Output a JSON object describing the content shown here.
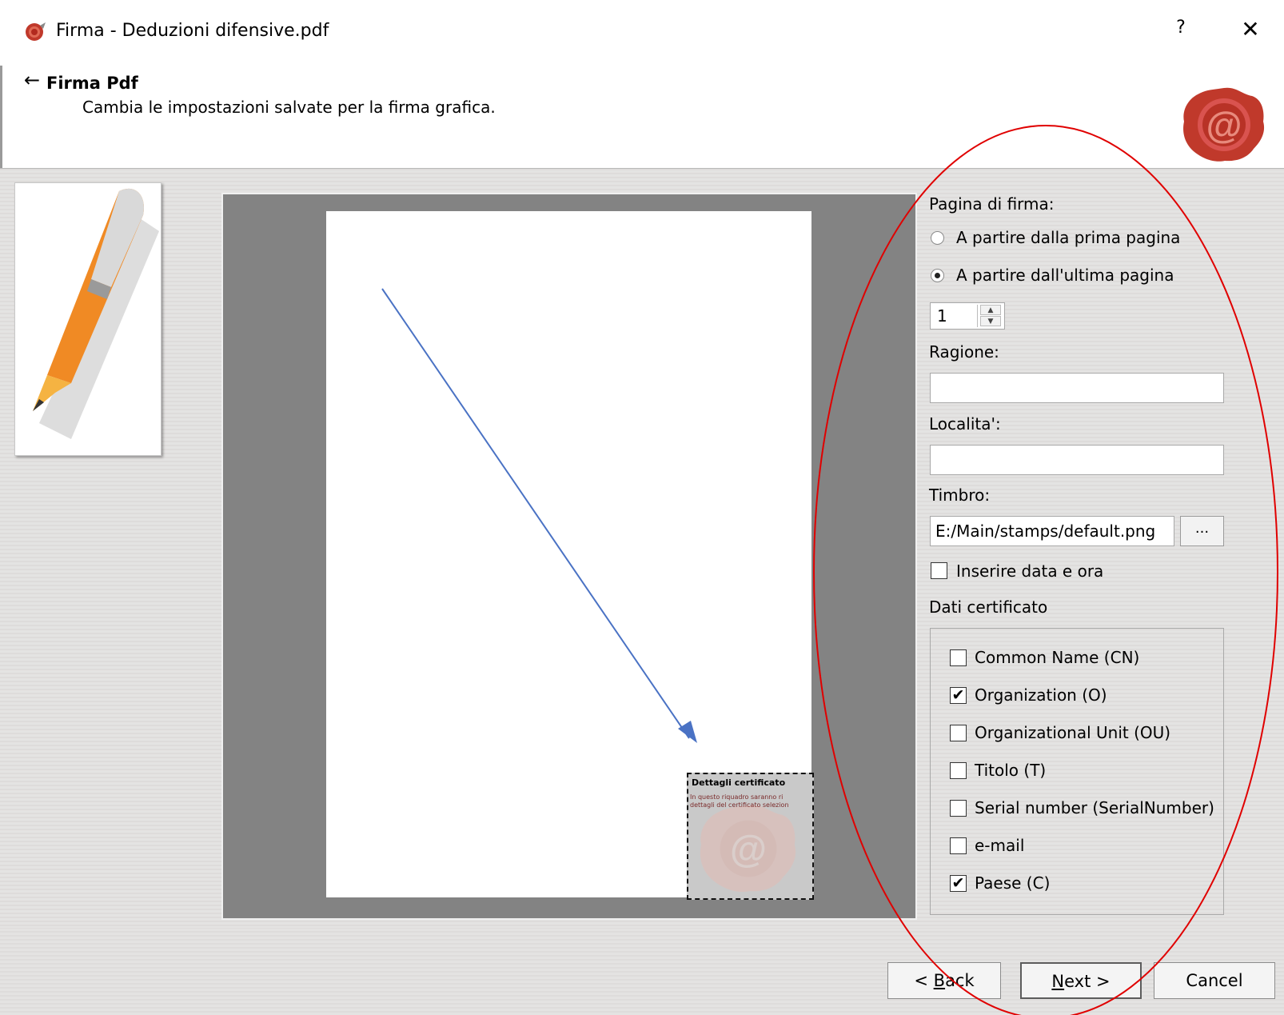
{
  "window": {
    "title": "Firma - Deduzioni difensive.pdf",
    "help": "?",
    "close": "✕"
  },
  "header": {
    "back": "←",
    "title": "Firma Pdf",
    "subtitle": "Cambia le impostazioni salvate per la firma grafica."
  },
  "preview": {
    "stamp_title": "Dettagli certificato",
    "stamp_line1": "In questo riquadro saranno ri",
    "stamp_line2": "dettagli del certificato selezion"
  },
  "panel": {
    "page_label": "Pagina di firma:",
    "radio_first": "A partire dalla prima pagina",
    "radio_last": "A partire dall'ultima pagina",
    "radio_selected": "last",
    "page_number": "1",
    "ragione_label": "Ragione:",
    "ragione_value": "",
    "localita_label": "Localita':",
    "localita_value": "",
    "timbro_label": "Timbro:",
    "timbro_value": "E:/Main/stamps/default.png",
    "browse": "...",
    "datetime_label": "Inserire data e ora",
    "datetime_checked": false,
    "cert_label": "Dati certificato",
    "cert_items": [
      {
        "label": "Common Name (CN)",
        "checked": false
      },
      {
        "label": "Organization (O)",
        "checked": true
      },
      {
        "label": "Organizational Unit (OU)",
        "checked": false
      },
      {
        "label": "Titolo (T)",
        "checked": false
      },
      {
        "label": "Serial number (SerialNumber)",
        "checked": false
      },
      {
        "label": "e-mail",
        "checked": false
      },
      {
        "label": "Paese (C)",
        "checked": true
      }
    ]
  },
  "footer": {
    "back_label_accel": "B",
    "back_label_rest": "ack",
    "back_prefix": "< ",
    "next_label_accel": "N",
    "next_label_rest": "ext >",
    "cancel_label": "Cancel"
  },
  "colors": {
    "annotation_ellipse": "#e00000",
    "annotation_arrow": "#4a72c4",
    "preview_bg": "#838383",
    "seal_red": "#c0392b"
  },
  "check_mark": "✔"
}
